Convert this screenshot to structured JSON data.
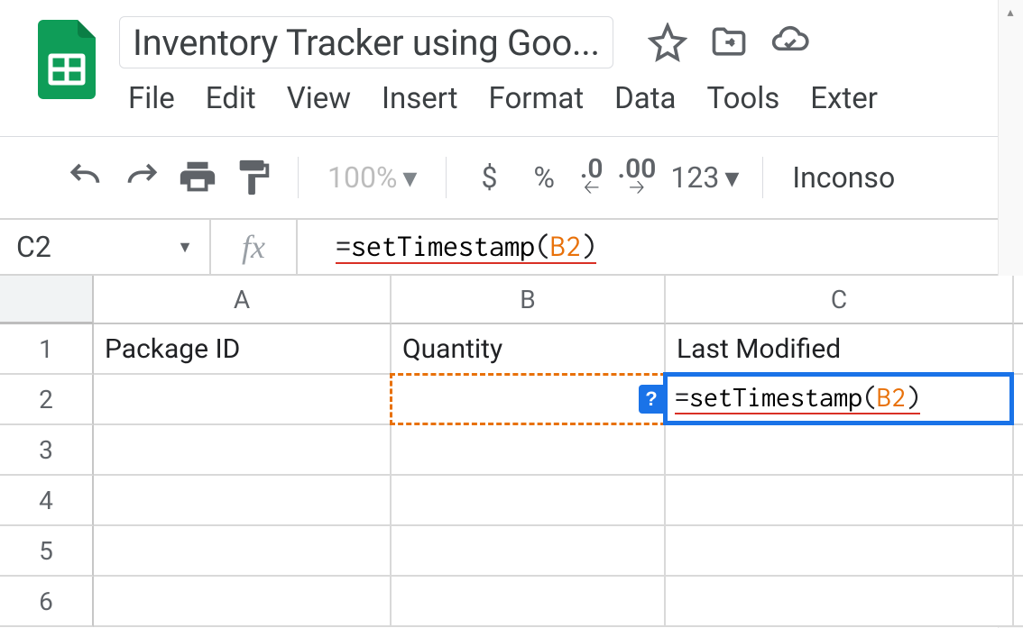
{
  "doc": {
    "title": "Inventory Tracker using Goo..."
  },
  "menu": {
    "file": "File",
    "edit": "Edit",
    "view": "View",
    "insert": "Insert",
    "format": "Format",
    "data": "Data",
    "tools": "Tools",
    "extensions": "Exter"
  },
  "toolbar": {
    "zoom": "100%",
    "currency": "$",
    "percent": "%",
    "dec_less": ".0",
    "dec_more": ".00",
    "numfmt": "123",
    "font": "Inconso"
  },
  "formula_bar": {
    "cell_ref": "C2",
    "fx": "fx",
    "eq": "=",
    "fn": "setTimestamp",
    "open": "(",
    "arg": "B2",
    "close": ")"
  },
  "columns": {
    "a": "A",
    "b": "B",
    "c": "C"
  },
  "rows": {
    "r1": "1",
    "r2": "2",
    "r3": "3",
    "r4": "4",
    "r5": "5",
    "r6": "6"
  },
  "cells": {
    "a1": "Package ID",
    "b1": "Quantity",
    "c1": "Last Modified",
    "c2_eq": "=",
    "c2_fn": "setTimestamp",
    "c2_open": "(",
    "c2_arg": "B2",
    "c2_close": ")",
    "help_badge": "?"
  }
}
